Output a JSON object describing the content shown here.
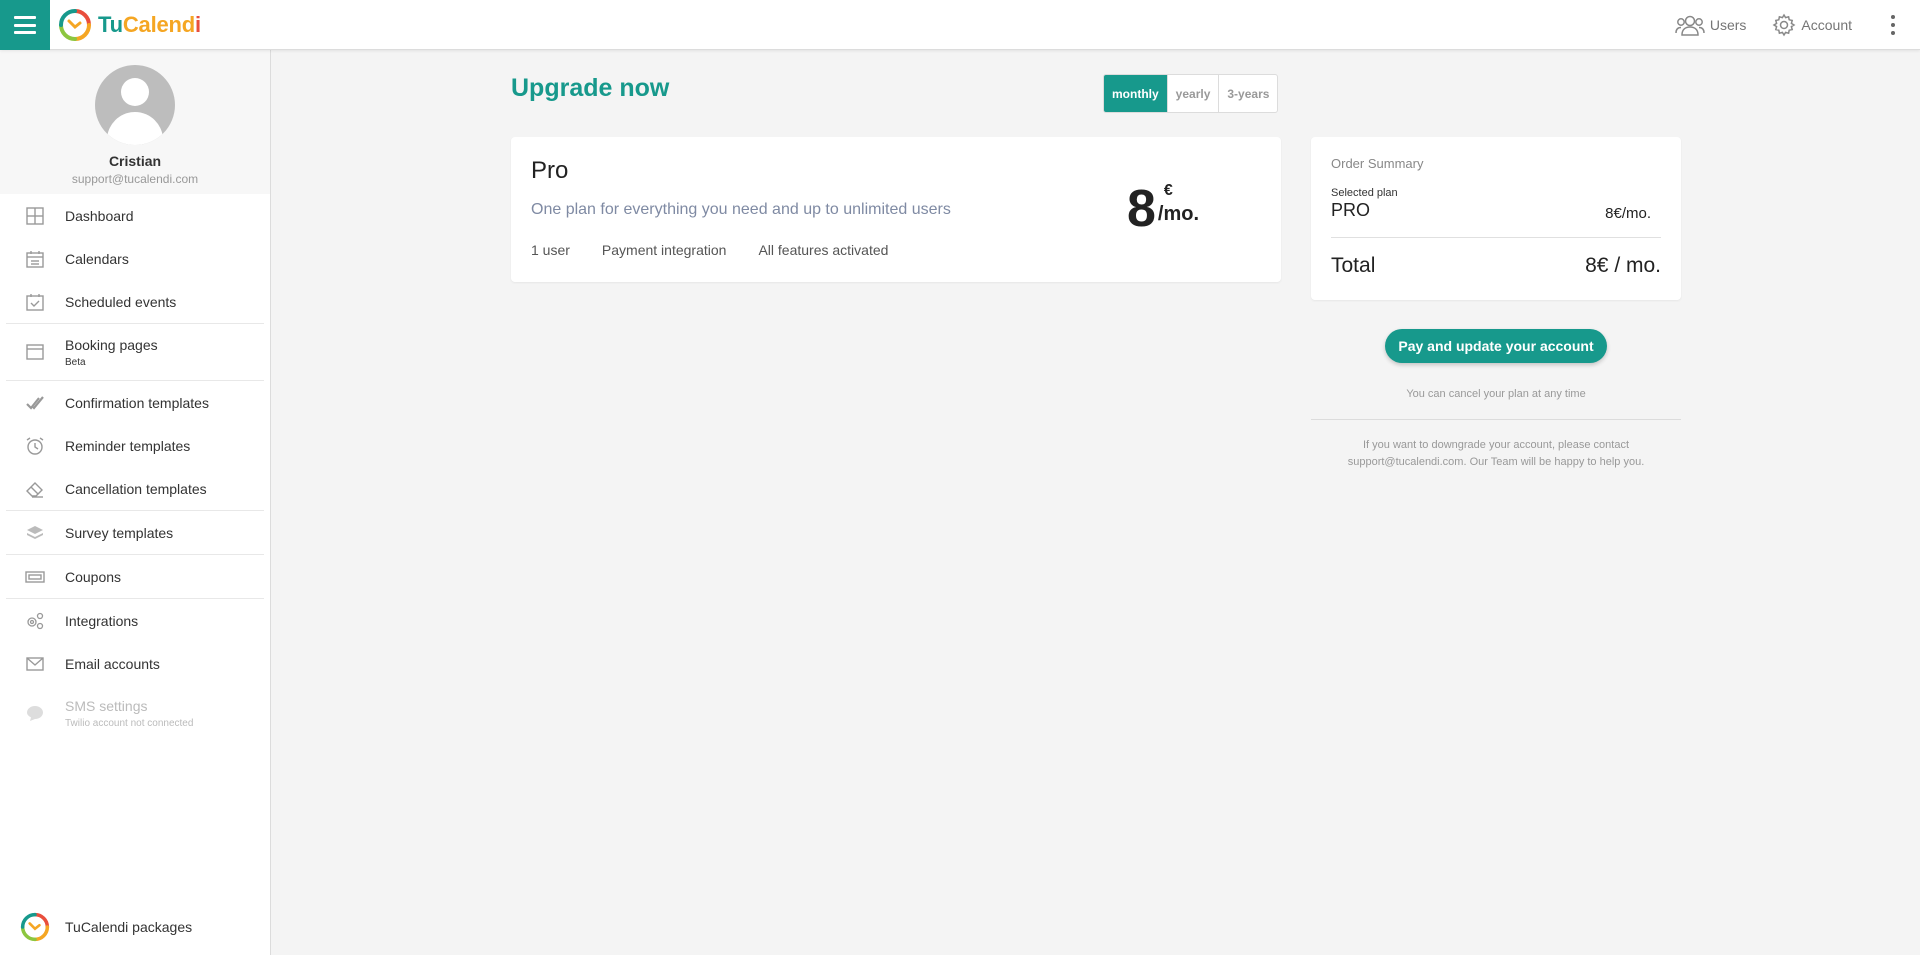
{
  "brand": {
    "tu": "Tu",
    "calend": "Calend",
    "i": "i"
  },
  "topbar": {
    "users_label": "Users",
    "account_label": "Account"
  },
  "profile": {
    "name": "Cristian",
    "email": "support@tucalendi.com"
  },
  "sidebar": {
    "items": [
      {
        "label": "Dashboard",
        "icon": "dashboard-icon"
      },
      {
        "label": "Calendars",
        "icon": "calendar-icon"
      },
      {
        "label": "Scheduled events",
        "icon": "calendar-check-icon"
      },
      {
        "label": "Booking pages",
        "sub": "Beta",
        "icon": "browser-window-icon"
      },
      {
        "label": "Confirmation templates",
        "icon": "double-check-icon"
      },
      {
        "label": "Reminder templates",
        "icon": "alarm-clock-icon"
      },
      {
        "label": "Cancellation templates",
        "icon": "eraser-icon"
      },
      {
        "label": "Survey templates",
        "icon": "layers-icon"
      },
      {
        "label": "Coupons",
        "icon": "ticket-icon"
      },
      {
        "label": "Integrations",
        "icon": "gears-icon"
      },
      {
        "label": "Email accounts",
        "icon": "envelope-icon"
      },
      {
        "label": "SMS settings",
        "sub": "Twilio account not connected",
        "icon": "sms-bubble-icon"
      }
    ],
    "packages_label": "TuCalendi packages"
  },
  "main": {
    "title": "Upgrade now",
    "periods": [
      "monthly",
      "yearly",
      "3-years"
    ],
    "active_period": "monthly"
  },
  "plan": {
    "name": "Pro",
    "description": "One plan for everything you need and up to unlimited users",
    "features": [
      "1 user",
      "Payment integration",
      "All features activated"
    ],
    "price": "8",
    "currency": "€",
    "per": "/mo."
  },
  "summary": {
    "title": "Order Summary",
    "selected_label": "Selected plan",
    "selected_plan": "PRO",
    "selected_price": "8€/mo.",
    "total_label": "Total",
    "total_value": "8€ / mo."
  },
  "pay_button": "Pay and update your account",
  "cancel_note": "You can cancel your plan at any time",
  "downgrade_note": "If you want to downgrade your account, please contact support@tucalendi.com. Our Team will be happy to help you.",
  "colors": {
    "accent": "#17998c",
    "brand_orange": "#f5a623",
    "brand_red": "#e94e3c"
  }
}
